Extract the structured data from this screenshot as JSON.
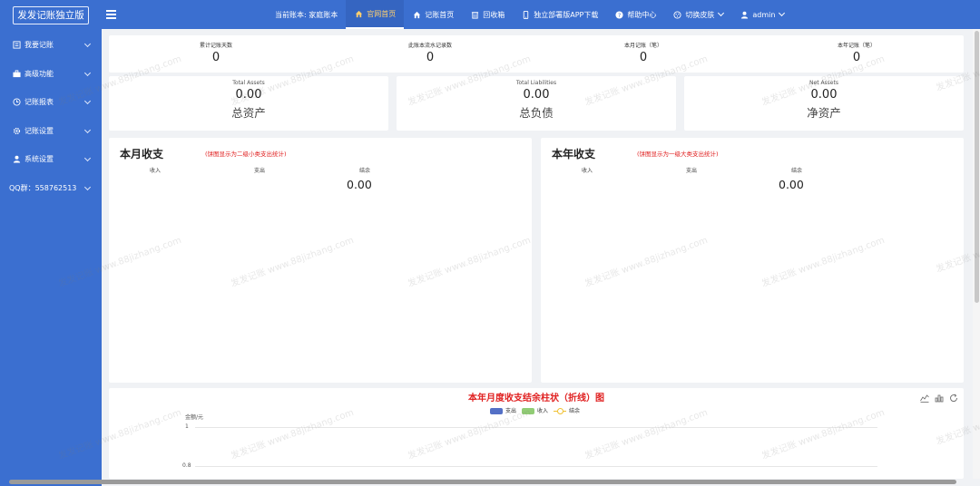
{
  "app": {
    "title": "发发记账独立版"
  },
  "topnav": {
    "current_book_label": "当前账本: 家庭账本",
    "items": [
      {
        "label": "官网首页",
        "icon": "home-icon"
      },
      {
        "label": "记账首页",
        "icon": "home-icon"
      },
      {
        "label": "回收箱",
        "icon": "trash-icon"
      },
      {
        "label": "独立部署版APP下载",
        "icon": "mobile-icon"
      },
      {
        "label": "帮助中心",
        "icon": "help-icon"
      },
      {
        "label": "切换皮肤",
        "icon": "palette-icon"
      },
      {
        "label": "admin",
        "icon": "user-icon"
      }
    ]
  },
  "sidebar": {
    "items": [
      {
        "label": "我要记账",
        "icon": "list-icon"
      },
      {
        "label": "高级功能",
        "icon": "briefcase-icon"
      },
      {
        "label": "记账报表",
        "icon": "clock-icon"
      },
      {
        "label": "记账设置",
        "icon": "gear-icon"
      },
      {
        "label": "系统设置",
        "icon": "user-icon"
      }
    ],
    "qq": "QQ群：558762513"
  },
  "stats": [
    {
      "label": "累计记账天数",
      "value": "0"
    },
    {
      "label": "此账本流水记录数",
      "value": "0"
    },
    {
      "label": "本月记账（笔）",
      "value": "0"
    },
    {
      "label": "本年记账（笔）",
      "value": "0"
    }
  ],
  "assets": [
    {
      "en": "Total Assets",
      "value": "0.00",
      "cn": "总资产"
    },
    {
      "en": "Total Liabilities",
      "value": "0.00",
      "cn": "总负债"
    },
    {
      "en": "Net Assets",
      "value": "0.00",
      "cn": "净资产"
    }
  ],
  "month_panel": {
    "title": "本月收支",
    "note": "(饼图显示为二级小类支出统计)",
    "labels": {
      "income": "收入",
      "expense": "支出",
      "balance": "结余"
    },
    "balance_value": "0.00"
  },
  "year_panel": {
    "title": "本年收支",
    "note": "(饼图显示为一级大类支出统计)",
    "labels": {
      "income": "收入",
      "expense": "支出",
      "balance": "结余"
    },
    "balance_value": "0.00"
  },
  "chart": {
    "title": "本年月度收支结余柱状（折线）图",
    "legend": [
      "支出",
      "收入",
      "结余"
    ],
    "colors": {
      "expense": "#5470c6",
      "income": "#91cc75",
      "balance": "#fac858"
    },
    "y_axis_name": "金额/元",
    "y_ticks": [
      "1",
      "0.8"
    ]
  },
  "chart_data": {
    "type": "bar",
    "title": "本年月度收支结余柱状（折线）图",
    "ylabel": "金额/元",
    "series": [
      {
        "name": "支出",
        "values": []
      },
      {
        "name": "收入",
        "values": []
      },
      {
        "name": "结余",
        "values": []
      }
    ],
    "y_ticks": [
      1,
      0.8
    ]
  },
  "watermark": "发发记账 www.88jizhang.com"
}
